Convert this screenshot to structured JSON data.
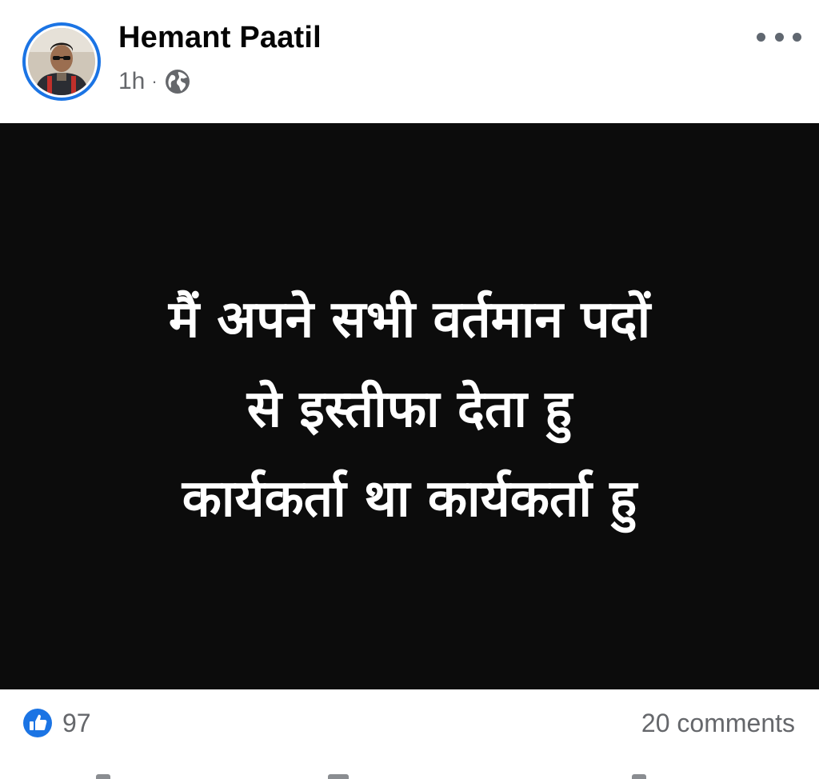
{
  "post": {
    "author": {
      "name": "Hemant Paatil"
    },
    "timestamp": "1h",
    "separator": "·",
    "audience_icon": "globe-icon",
    "menu_icon": "more-horizontal-icon",
    "media": {
      "background_color": "#0c0c0c",
      "text_color": "#ffffff",
      "lines": [
        "मैं अपने सभी वर्तमान पदों",
        "से इस्तीफा देता हु",
        "कार्यकर्ता था कार्यकर्ता हु"
      ]
    },
    "reactions": {
      "icon": "like-icon",
      "count": "97"
    },
    "comments": {
      "label": "20 comments"
    }
  },
  "colors": {
    "accent": "#1b74e4",
    "secondary_text": "#65676b",
    "primary_text": "#050505"
  }
}
